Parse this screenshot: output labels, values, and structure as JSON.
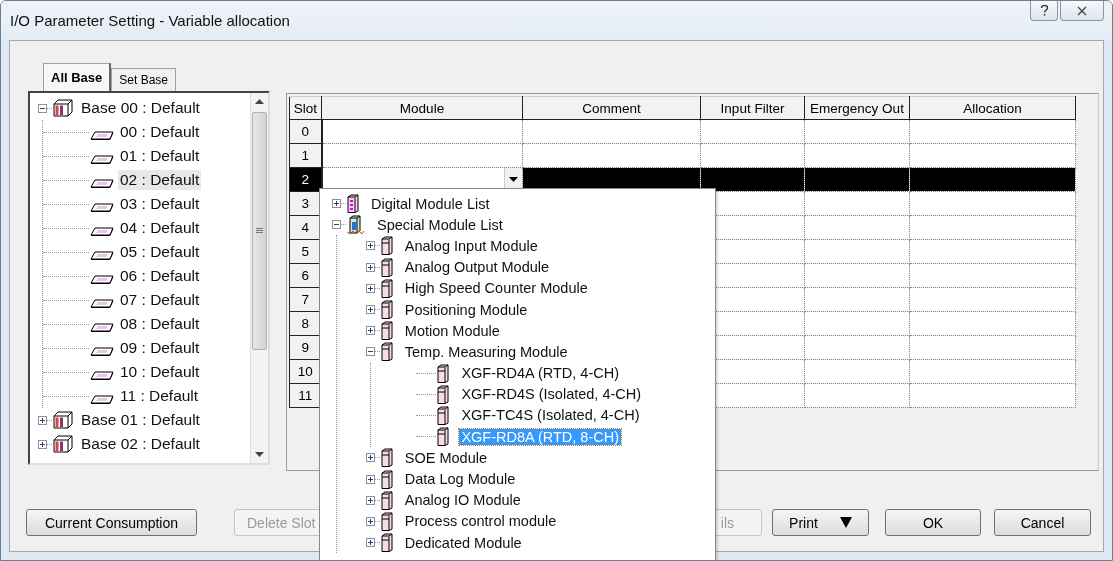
{
  "window": {
    "title": "I/O Parameter Setting - Variable allocation"
  },
  "tabs": [
    {
      "label": "All Base",
      "selected": true
    },
    {
      "label": "Set Base",
      "selected": false
    }
  ],
  "base_tree": [
    {
      "label": "Base 00 : Default",
      "expanded": true,
      "selected": false,
      "children": [
        {
          "label": "00 : Default",
          "selected": false
        },
        {
          "label": "01 : Default",
          "selected": false
        },
        {
          "label": "02 : Default",
          "selected": true
        },
        {
          "label": "03 : Default",
          "selected": false
        },
        {
          "label": "04 : Default",
          "selected": false
        },
        {
          "label": "05 : Default",
          "selected": false
        },
        {
          "label": "06 : Default",
          "selected": false
        },
        {
          "label": "07 : Default",
          "selected": false
        },
        {
          "label": "08 : Default",
          "selected": false
        },
        {
          "label": "09 : Default",
          "selected": false
        },
        {
          "label": "10 : Default",
          "selected": false
        },
        {
          "label": "11 : Default",
          "selected": false
        }
      ]
    },
    {
      "label": "Base 01 : Default",
      "expanded": false,
      "selected": false
    },
    {
      "label": "Base 02 : Default",
      "expanded": false,
      "selected": false
    }
  ],
  "grid": {
    "columns": [
      "Slot",
      "Module",
      "Comment",
      "Input Filter",
      "Emergency Out",
      "Allocation"
    ],
    "rows": [
      {
        "slot": "0",
        "selected": false
      },
      {
        "slot": "1",
        "selected": false
      },
      {
        "slot": "2",
        "selected": true
      },
      {
        "slot": "3",
        "selected": false
      },
      {
        "slot": "4",
        "selected": false
      },
      {
        "slot": "5",
        "selected": false
      },
      {
        "slot": "6",
        "selected": false
      },
      {
        "slot": "7",
        "selected": false
      },
      {
        "slot": "8",
        "selected": false
      },
      {
        "slot": "9",
        "selected": false
      },
      {
        "slot": "10",
        "selected": false
      },
      {
        "slot": "11",
        "selected": false
      }
    ]
  },
  "module_dropdown": {
    "items": [
      {
        "label": "Digital Module List",
        "kind": "digital",
        "expanded": false,
        "selected": false
      },
      {
        "label": "Special Module List",
        "kind": "special",
        "expanded": true,
        "selected": false,
        "children": [
          {
            "label": "Analog Input Module",
            "kind": "module",
            "expanded": false,
            "selected": false
          },
          {
            "label": "Analog Output Module",
            "kind": "module",
            "expanded": false,
            "selected": false
          },
          {
            "label": "High Speed Counter Module",
            "kind": "module",
            "expanded": false,
            "selected": false
          },
          {
            "label": "Positioning Module",
            "kind": "module",
            "expanded": false,
            "selected": false
          },
          {
            "label": "Motion Module",
            "kind": "module",
            "expanded": false,
            "selected": false
          },
          {
            "label": "Temp. Measuring Module",
            "kind": "module",
            "expanded": true,
            "selected": false,
            "children": [
              {
                "label": "XGF-RD4A (RTD, 4-CH)",
                "kind": "module",
                "selected": false
              },
              {
                "label": "XGF-RD4S (Isolated, 4-CH)",
                "kind": "module",
                "selected": false
              },
              {
                "label": "XGF-TC4S (Isolated, 4-CH)",
                "kind": "module",
                "selected": false
              },
              {
                "label": "XGF-RD8A (RTD, 8-CH)",
                "kind": "module",
                "selected": true
              }
            ]
          },
          {
            "label": "SOE Module",
            "kind": "module",
            "expanded": false,
            "selected": false
          },
          {
            "label": "Data Log Module",
            "kind": "module",
            "expanded": false,
            "selected": false
          },
          {
            "label": "Analog IO Module",
            "kind": "module",
            "expanded": false,
            "selected": false
          },
          {
            "label": "Process control module",
            "kind": "module",
            "expanded": false,
            "selected": false
          },
          {
            "label": "Dedicated Module",
            "kind": "module",
            "expanded": false,
            "selected": false
          }
        ]
      }
    ]
  },
  "buttons": [
    {
      "label": "Current Consumption",
      "kind": "plain",
      "disabled": false
    },
    {
      "label": "Delete Slot",
      "kind": "plain",
      "disabled": true
    },
    {
      "label": "ils",
      "kind": "plain",
      "disabled": true
    },
    {
      "label": "Print",
      "kind": "menu",
      "disabled": false
    },
    {
      "label": "OK",
      "kind": "plain",
      "disabled": false
    },
    {
      "label": "Cancel",
      "kind": "plain",
      "disabled": false
    }
  ]
}
